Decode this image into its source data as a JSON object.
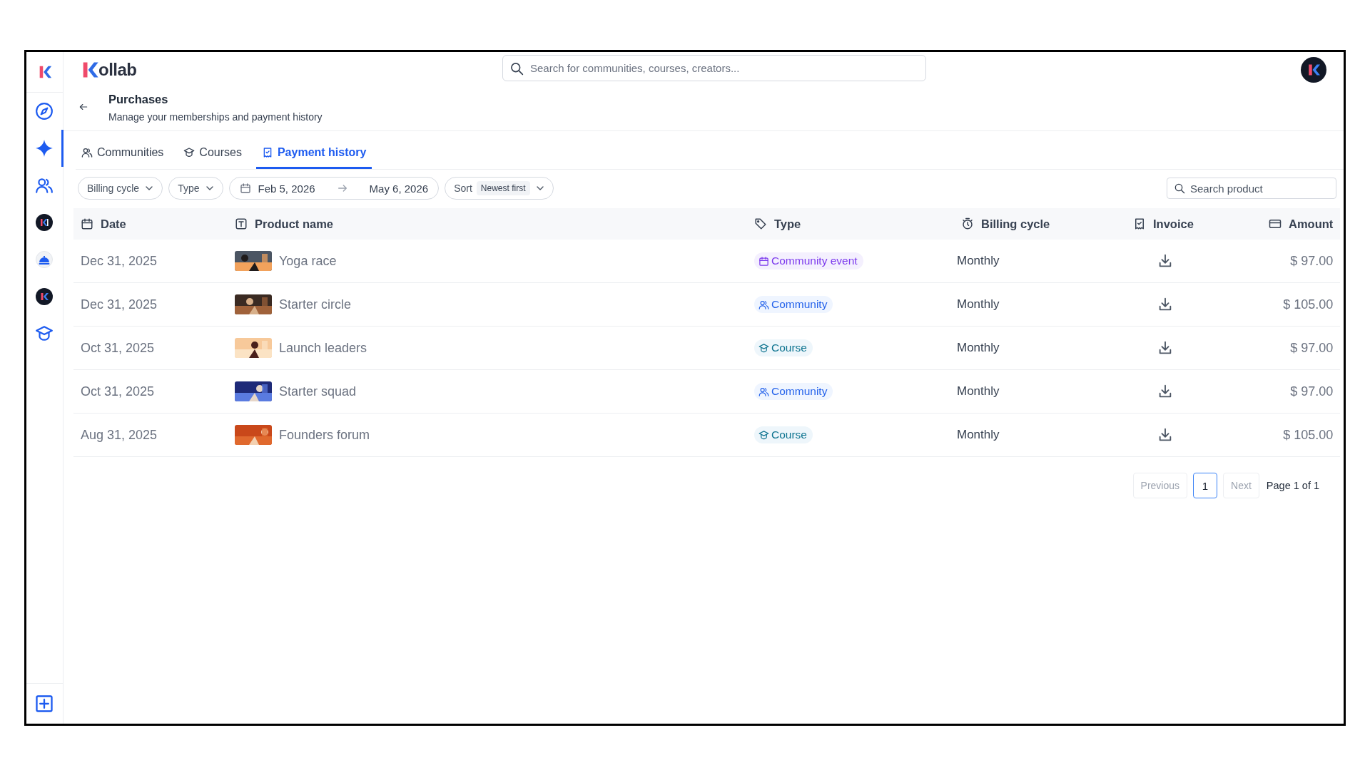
{
  "brand": {
    "name": "ollab"
  },
  "search": {
    "placeholder": "Search for communities, courses, creators..."
  },
  "sidebar": {
    "items": [
      {
        "kind": "compass",
        "selected": false
      },
      {
        "kind": "sparkle",
        "selected": true
      },
      {
        "kind": "people",
        "selected": false
      },
      {
        "kind": "avatar-k1",
        "selected": false
      },
      {
        "kind": "bell",
        "selected": false
      },
      {
        "kind": "avatar-k",
        "selected": false
      },
      {
        "kind": "cap",
        "selected": false
      }
    ]
  },
  "page": {
    "title": "Purchases",
    "subtitle": "Manage your memberships and payment history"
  },
  "tabs": [
    {
      "label": "Communities",
      "kind": "people",
      "selected": false
    },
    {
      "label": "Courses",
      "kind": "cap",
      "selected": false
    },
    {
      "label": "Payment history",
      "kind": "receipt",
      "selected": true
    }
  ],
  "filters": [
    {
      "kind": "dropdown",
      "label": "Billing cycle"
    },
    {
      "kind": "dropdown",
      "label": "Type"
    },
    {
      "kind": "daterange",
      "start": "Feb 5, 2026",
      "end": "May 6, 2026"
    },
    {
      "kind": "sort",
      "label": "Sort",
      "value": "Newest first"
    }
  ],
  "product_search": {
    "placeholder": "Search product"
  },
  "table": {
    "columns": [
      {
        "label": "Date",
        "kind": "date"
      },
      {
        "label": "Product name",
        "kind": "product"
      },
      {
        "label": "Type",
        "kind": "type"
      },
      {
        "label": "Billing cycle",
        "kind": "billing"
      },
      {
        "label": "Invoice",
        "kind": "invoice"
      },
      {
        "label": "Amount",
        "kind": "amount"
      }
    ],
    "rows": [
      {
        "date": "Dec 31, 2025",
        "product": "Yoga race",
        "type": {
          "label": "Community event",
          "kind": "event"
        },
        "billing_cycle": "Monthly",
        "amount": "$ 97.00"
      },
      {
        "date": "Dec 31, 2025",
        "product": "Starter circle",
        "type": {
          "label": "Community",
          "kind": "community"
        },
        "billing_cycle": "Monthly",
        "amount": "$ 105.00"
      },
      {
        "date": "Oct 31, 2025",
        "product": "Launch leaders",
        "type": {
          "label": "Course",
          "kind": "course"
        },
        "billing_cycle": "Monthly",
        "amount": "$ 97.00"
      },
      {
        "date": "Oct 31, 2025",
        "product": "Starter squad",
        "type": {
          "label": "Community",
          "kind": "community"
        },
        "billing_cycle": "Monthly",
        "amount": "$ 97.00"
      },
      {
        "date": "Aug 31, 2025",
        "product": "Founders forum",
        "type": {
          "label": "Course",
          "kind": "course"
        },
        "billing_cycle": "Monthly",
        "amount": "$ 105.00"
      }
    ]
  },
  "pagination": {
    "previous": {
      "label": "Previous",
      "disabled": true
    },
    "pages": [
      {
        "label": "1",
        "selected": true
      }
    ],
    "next": {
      "label": "Next",
      "disabled": true
    },
    "summary": "Page 1 of 1"
  }
}
